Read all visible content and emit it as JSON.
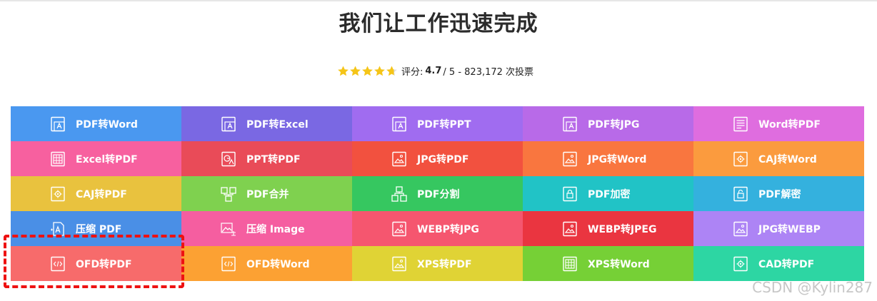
{
  "header": {
    "title": "我们让工作迅速完成"
  },
  "rating": {
    "stars": 4.7,
    "prefix": "评分: ",
    "score": "4.7",
    "suffix": " / 5 - 823,172 次投票",
    "star_color": "#f5c518"
  },
  "tools": [
    {
      "label": "PDF转Word",
      "color": "#4a98f0",
      "icon": "document-a-icon"
    },
    {
      "label": "PDF转Excel",
      "color": "#7a68e3",
      "icon": "document-a-icon"
    },
    {
      "label": "PDF转PPT",
      "color": "#a06cf0",
      "icon": "document-a-icon"
    },
    {
      "label": "PDF转JPG",
      "color": "#b86ae8",
      "icon": "document-a-icon"
    },
    {
      "label": "Word转PDF",
      "color": "#df6ddf",
      "icon": "document-lines-icon"
    },
    {
      "label": "Excel转PDF",
      "color": "#f7609f",
      "icon": "table-icon"
    },
    {
      "label": "PPT转PDF",
      "color": "#e94b58",
      "icon": "slide-icon"
    },
    {
      "label": "JPG转PDF",
      "color": "#f2513f",
      "icon": "image-icon"
    },
    {
      "label": "JPG转Word",
      "color": "#f9763f",
      "icon": "image-icon"
    },
    {
      "label": "CAJ转Word",
      "color": "#fb9b3e",
      "icon": "gear-document-icon"
    },
    {
      "label": "CAJ转PDF",
      "color": "#e9c23e",
      "icon": "gear-document-icon"
    },
    {
      "label": "PDF合并",
      "color": "#7fd14f",
      "icon": "merge-icon"
    },
    {
      "label": "PDF分割",
      "color": "#36c760",
      "icon": "split-icon"
    },
    {
      "label": "PDF加密",
      "color": "#21c3c6",
      "icon": "lock-icon"
    },
    {
      "label": "PDF解密",
      "color": "#34b1de",
      "icon": "unlock-icon"
    },
    {
      "label": "压缩 PDF",
      "color": "#4a8fe6",
      "icon": "compress-icon"
    },
    {
      "label": "压缩 Image",
      "color": "#f55ea0",
      "icon": "compress-image-icon"
    },
    {
      "label": "WEBP转JPG",
      "color": "#f5566f",
      "icon": "image-icon"
    },
    {
      "label": "WEBP转JPEG",
      "color": "#ea3540",
      "icon": "image-icon"
    },
    {
      "label": "JPG转WEBP",
      "color": "#ad84f5",
      "icon": "image-icon"
    },
    {
      "label": "OFD转PDF",
      "color": "#f76b6b",
      "icon": "code-document-icon"
    },
    {
      "label": "OFD转Word",
      "color": "#fca133",
      "icon": "code-document-icon"
    },
    {
      "label": "XPS转PDF",
      "color": "#e0d335",
      "icon": "image-icon"
    },
    {
      "label": "XPS转Word",
      "color": "#76d036",
      "icon": "table-icon"
    },
    {
      "label": "CAD转PDF",
      "color": "#2dd6a3",
      "icon": "gear-document-icon"
    }
  ],
  "watermark": "CSDN @Kylin287"
}
